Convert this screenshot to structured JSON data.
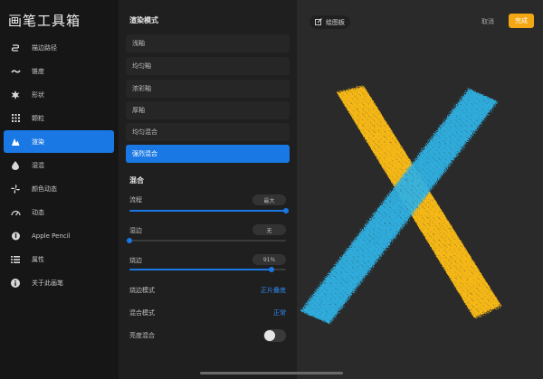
{
  "sidebar": {
    "title": "画笔工具箱",
    "items": [
      {
        "label": "描边路径",
        "icon": "stroke-path-icon"
      },
      {
        "label": "锥度",
        "icon": "taper-icon"
      },
      {
        "label": "形状",
        "icon": "shape-icon"
      },
      {
        "label": "颗粒",
        "icon": "grain-icon"
      },
      {
        "label": "渲染",
        "icon": "render-icon",
        "active": true
      },
      {
        "label": "湿混",
        "icon": "wet-mix-icon"
      },
      {
        "label": "颜色动态",
        "icon": "color-dynamics-icon"
      },
      {
        "label": "动态",
        "icon": "dynamics-icon"
      },
      {
        "label": "Apple Pencil",
        "icon": "apple-pencil-icon"
      },
      {
        "label": "属性",
        "icon": "properties-icon"
      },
      {
        "label": "关于此画笔",
        "icon": "info-icon"
      }
    ]
  },
  "render_mode": {
    "title": "渲染模式",
    "options": [
      {
        "label": "浅釉"
      },
      {
        "label": "均匀釉"
      },
      {
        "label": "浓彩釉"
      },
      {
        "label": "厚釉"
      },
      {
        "label": "均匀混合"
      },
      {
        "label": "强烈混合",
        "active": true
      }
    ]
  },
  "blending": {
    "title": "混合",
    "sliders": [
      {
        "label": "流程",
        "value_text": "最大",
        "value": 1.0
      },
      {
        "label": "湿边",
        "value_text": "无",
        "value": 0.0
      },
      {
        "label": "烧边",
        "value_text": "91%",
        "value": 0.91
      }
    ],
    "burnt_edge_mode": {
      "label": "烧边模式",
      "value": "正片叠底"
    },
    "blend_mode": {
      "label": "混合模式",
      "value": "正常"
    },
    "luminance_blending": {
      "label": "亮度混合",
      "on": false
    }
  },
  "canvas": {
    "drawing_pad_label": "绘图板",
    "cancel_label": "取消",
    "done_label": "完成"
  },
  "colors": {
    "accent_blue": "#1a78e4",
    "done_orange": "#f3a712",
    "stroke_yellow": "#f5b818",
    "stroke_blue": "#2eb3e6"
  }
}
